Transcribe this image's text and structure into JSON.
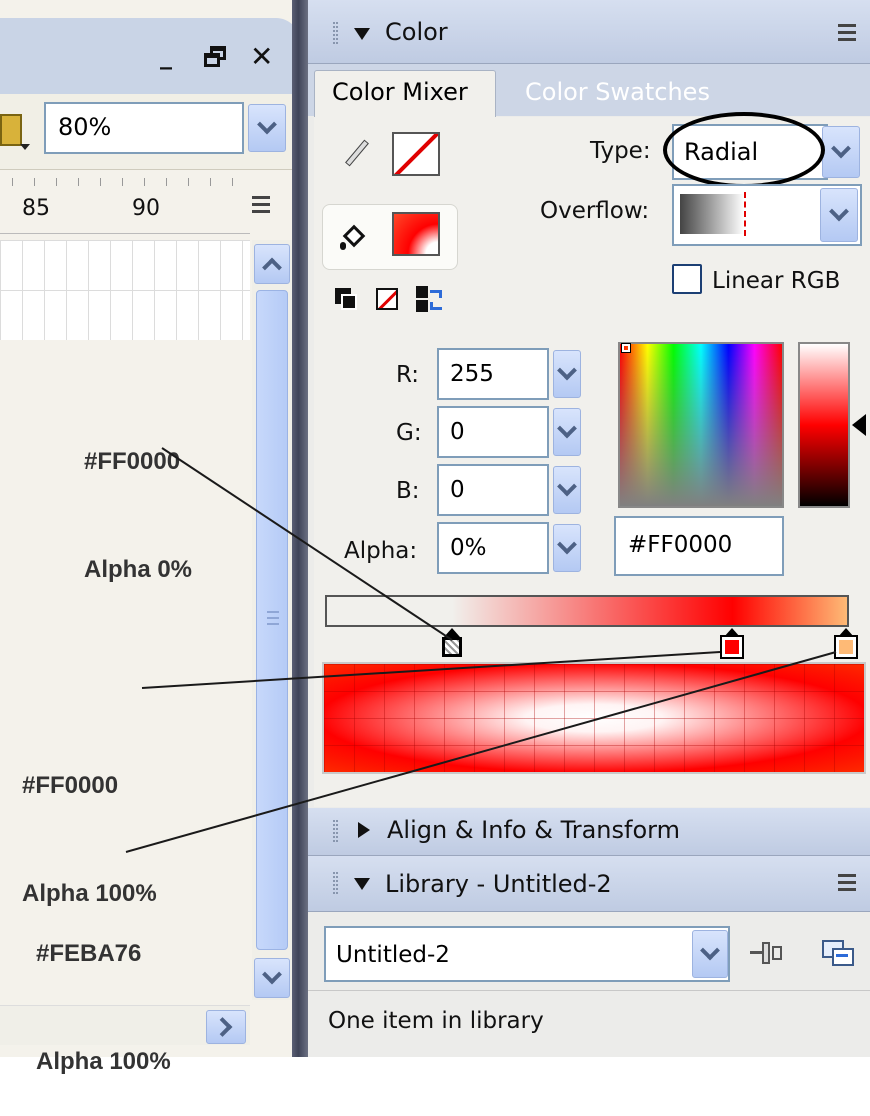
{
  "stage": {
    "zoom_value": "80%",
    "ruler_labels": [
      "85",
      "90"
    ],
    "window_buttons": [
      "minimize-icon",
      "restore-icon",
      "close-icon"
    ]
  },
  "annotations": [
    {
      "line1": "#FF0000",
      "line2": "Alpha 0%"
    },
    {
      "line1": "#FF0000",
      "line2": "Alpha 100%"
    },
    {
      "line1": "#FEBA76",
      "line2": "Alpha 100%"
    }
  ],
  "color_panel": {
    "title": "Color",
    "tabs": [
      "Color Mixer",
      "Color Swatches"
    ],
    "type_label": "Type:",
    "type_value": "Radial",
    "overflow_label": "Overflow:",
    "linear_rgb_label": "Linear RGB",
    "linear_rgb_checked": false,
    "fields": [
      {
        "label": "R:",
        "value": "255"
      },
      {
        "label": "G:",
        "value": "0"
      },
      {
        "label": "B:",
        "value": "0"
      },
      {
        "label": "Alpha:",
        "value": "0%"
      }
    ],
    "hex_value": "#FF0000",
    "gradient_stops": [
      {
        "color": "#FF0000",
        "alpha": 0,
        "position": 0.24
      },
      {
        "color": "#FF0000",
        "alpha": 100,
        "position": 0.78
      },
      {
        "color": "#FEBA76",
        "alpha": 100,
        "position": 1.0
      }
    ],
    "colors": {
      "accent": "#FF0000",
      "stop_end": "#FEBA76"
    }
  },
  "align_panel": {
    "title": "Align & Info & Transform"
  },
  "library_panel": {
    "title": "Library - Untitled-2",
    "selected_document": "Untitled-2",
    "status": "One item in library"
  },
  "icons": [
    "pencil-icon",
    "paint-bucket-icon",
    "black-white-icon",
    "no-color-icon",
    "swap-colors-icon",
    "pin-icon",
    "new-library-icon",
    "panel-menu-icon"
  ]
}
